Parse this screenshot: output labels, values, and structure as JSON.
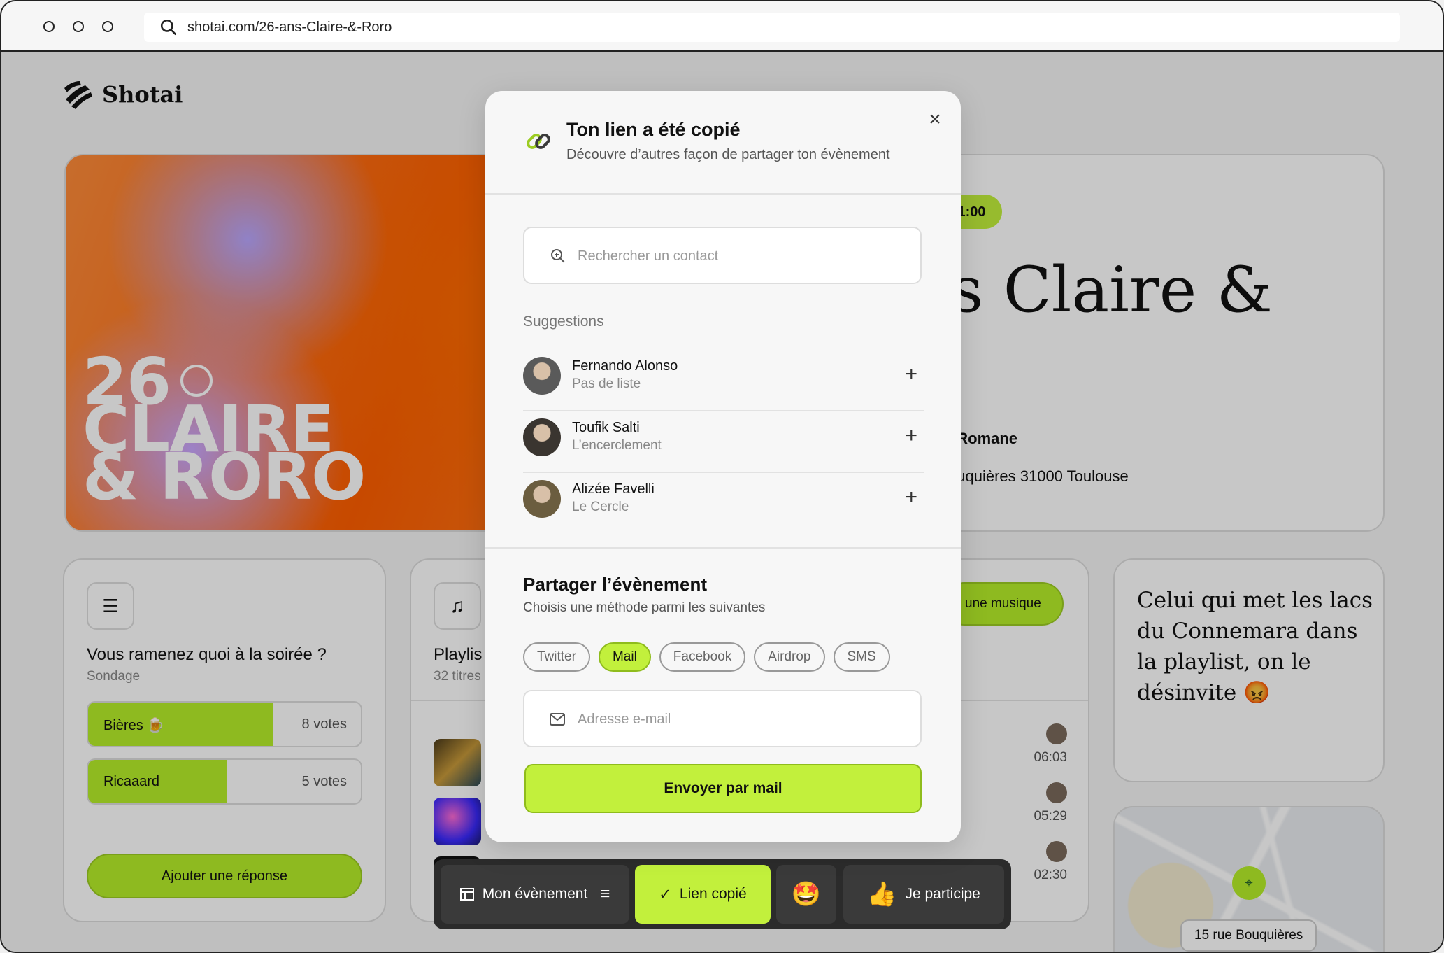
{
  "browser": {
    "url": "shotai.com/26-ans-Claire-&-Roro"
  },
  "brand": {
    "name": "Shotai"
  },
  "hero": {
    "art_text_line1": "26",
    "art_text_line2": "CLAIRE",
    "art_text_line3": "& RORO",
    "time": "21:00",
    "title_visible": "s Claire &",
    "host_prefix": ":",
    "host_name": "Romane",
    "address": "ouquières 31000 Toulouse"
  },
  "poll": {
    "question": "Vous ramenez quoi à la soirée ?",
    "type": "Sondage",
    "options": [
      {
        "label": "Bières 🍺",
        "votes": "8 votes",
        "share": 0.68
      },
      {
        "label": "Ricaaard",
        "votes": "5 votes",
        "share": 0.51
      }
    ],
    "add_label": "Ajouter une réponse"
  },
  "playlist": {
    "title": "Playlis",
    "count": "32 titres",
    "add_label": "une musique",
    "durations": [
      "06:03",
      "05:29",
      "02:30"
    ]
  },
  "quote": {
    "text": "Celui qui met les lacs du Connemara dans la playlist, on le désinvite 😡"
  },
  "map": {
    "label": "15 rue Bouquières"
  },
  "actionbar": {
    "event_label": "Mon évènement",
    "copied_label": "Lien copié",
    "emoji": "🤩",
    "participate_label": "Je participe"
  },
  "modal": {
    "title": "Ton lien a été copié",
    "subtitle": "Découvre d’autres façon de partager ton évènement",
    "search_placeholder": "Rechercher un contact",
    "suggestions_label": "Suggestions",
    "contacts": [
      {
        "name": "Fernando Alonso",
        "list": "Pas de liste",
        "avatar_color": "#5a5a5a"
      },
      {
        "name": "Toufik Salti",
        "list": "L’encerclement",
        "avatar_color": "#3a3530"
      },
      {
        "name": "Alizée Favelli",
        "list": "Le Cercle",
        "avatar_color": "#6b5d3f"
      }
    ],
    "share_title": "Partager l’évènement",
    "share_subtitle": "Choisis une méthode parmi les suivantes",
    "methods": [
      "Twitter",
      "Mail",
      "Facebook",
      "Airdrop",
      "SMS"
    ],
    "active_method": "Mail",
    "email_placeholder": "Adresse e-mail",
    "send_label": "Envoyer par mail"
  },
  "colors": {
    "accent": "#c2f03c",
    "accent_border": "#8fbc1c",
    "dark_bar": "#2b2b2b"
  }
}
